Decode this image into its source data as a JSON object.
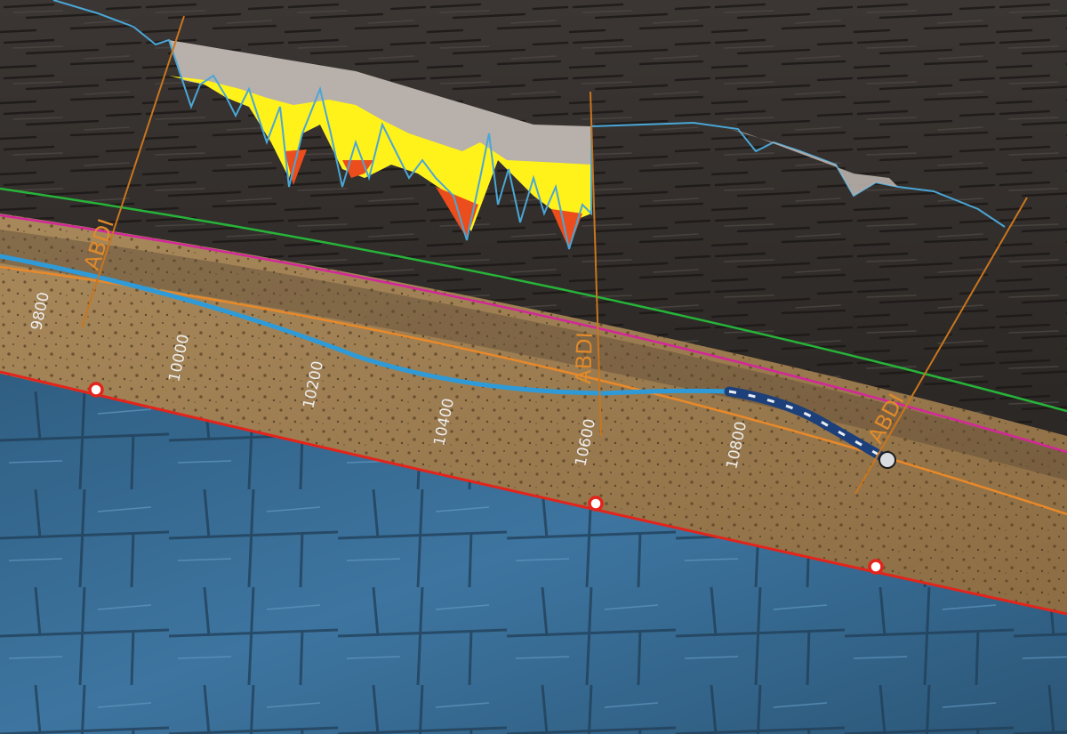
{
  "colors": {
    "shale": "#2e2a27",
    "sand_reservoir": "#9a7a4e",
    "basement": "#3b6f97",
    "green_horizon": "#27b43a",
    "magenta_horizon": "#d4279a",
    "orange_horizon": "#e8892a",
    "red_horizon": "#e3241b",
    "wellbore": "#2e9bd8",
    "abd_line": "#c8761f",
    "log_gray": "#b8b0aa",
    "log_yellow": "#fff21a",
    "log_red": "#ec4d1c",
    "log_outline": "#4aa6d6"
  },
  "depth_labels": [
    {
      "text": "9800"
    },
    {
      "text": "10000"
    },
    {
      "text": "10200"
    },
    {
      "text": "10400"
    },
    {
      "text": "10600"
    },
    {
      "text": "10800"
    }
  ],
  "abd_labels": [
    {
      "text": "ABDI"
    },
    {
      "text": "ABDI"
    },
    {
      "text": "ABDI"
    }
  ],
  "icons": [
    "drill-bit-icon",
    "red-marker-icon"
  ]
}
